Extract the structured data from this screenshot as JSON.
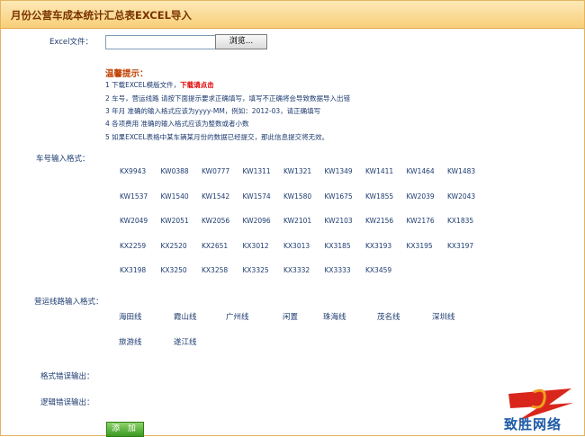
{
  "title": "月份公营车成本统计汇总表EXCEL导入",
  "excel_label": "Excel文件：",
  "browse_label": "浏览...",
  "file_value": "",
  "tips_title": "温馨提示：",
  "tips": [
    {
      "text": "1 下载EXCEL模版文件，",
      "link": "下载请点击"
    },
    {
      "text": "2 车号，营运线路 请按下面提示要求正确填写，填写不正确将会导致数据导入出错"
    },
    {
      "text": "3 年月 准确的输入格式应该为yyyy-MM，例如：2012-03，请正确填写"
    },
    {
      "text": "4 各项费用 准确的输入格式应该为整数或者小数"
    },
    {
      "text": "5 如果EXCEL表格中某车辆某月份的数据已经提交，那此信息提交将无效。"
    }
  ],
  "car_format_label": "车号输入格式：",
  "cars": [
    "KX9943",
    "KW0388",
    "KW0777",
    "KW1311",
    "KW1321",
    "KW1349",
    "KW1411",
    "KW1464",
    "KW1483",
    "KW1537",
    "KW1540",
    "KW1542",
    "KW1574",
    "KW1580",
    "KW1675",
    "KW1855",
    "KW2039",
    "KW2043",
    "KW2049",
    "KW2051",
    "KW2056",
    "KW2096",
    "KW2101",
    "KW2103",
    "KW2156",
    "KW2176",
    "KX1835",
    "KX2259",
    "KX2520",
    "KX2651",
    "KX3012",
    "KX3013",
    "KX3185",
    "KX3193",
    "KX3195",
    "KX3197",
    "KX3198",
    "KX3250",
    "KX3258",
    "KX3325",
    "KX3332",
    "KX3333",
    "KX3459"
  ],
  "route_format_label": "营运线路输入格式：",
  "routes": [
    "海田线",
    "霞山线",
    "广州线",
    "闲置",
    "珠海线",
    "茂名线",
    "深圳线",
    "旅游线",
    "遂江线"
  ],
  "format_error_label": "格式错误输出：",
  "logic_error_label": "逻辑错误输出：",
  "add_label": "添 加",
  "logo_text": "致胜网络",
  "colors": {
    "title_bg": "#f8cf79",
    "text": "#1d3b70",
    "link": "#e00000",
    "button": "#3a9a22"
  }
}
